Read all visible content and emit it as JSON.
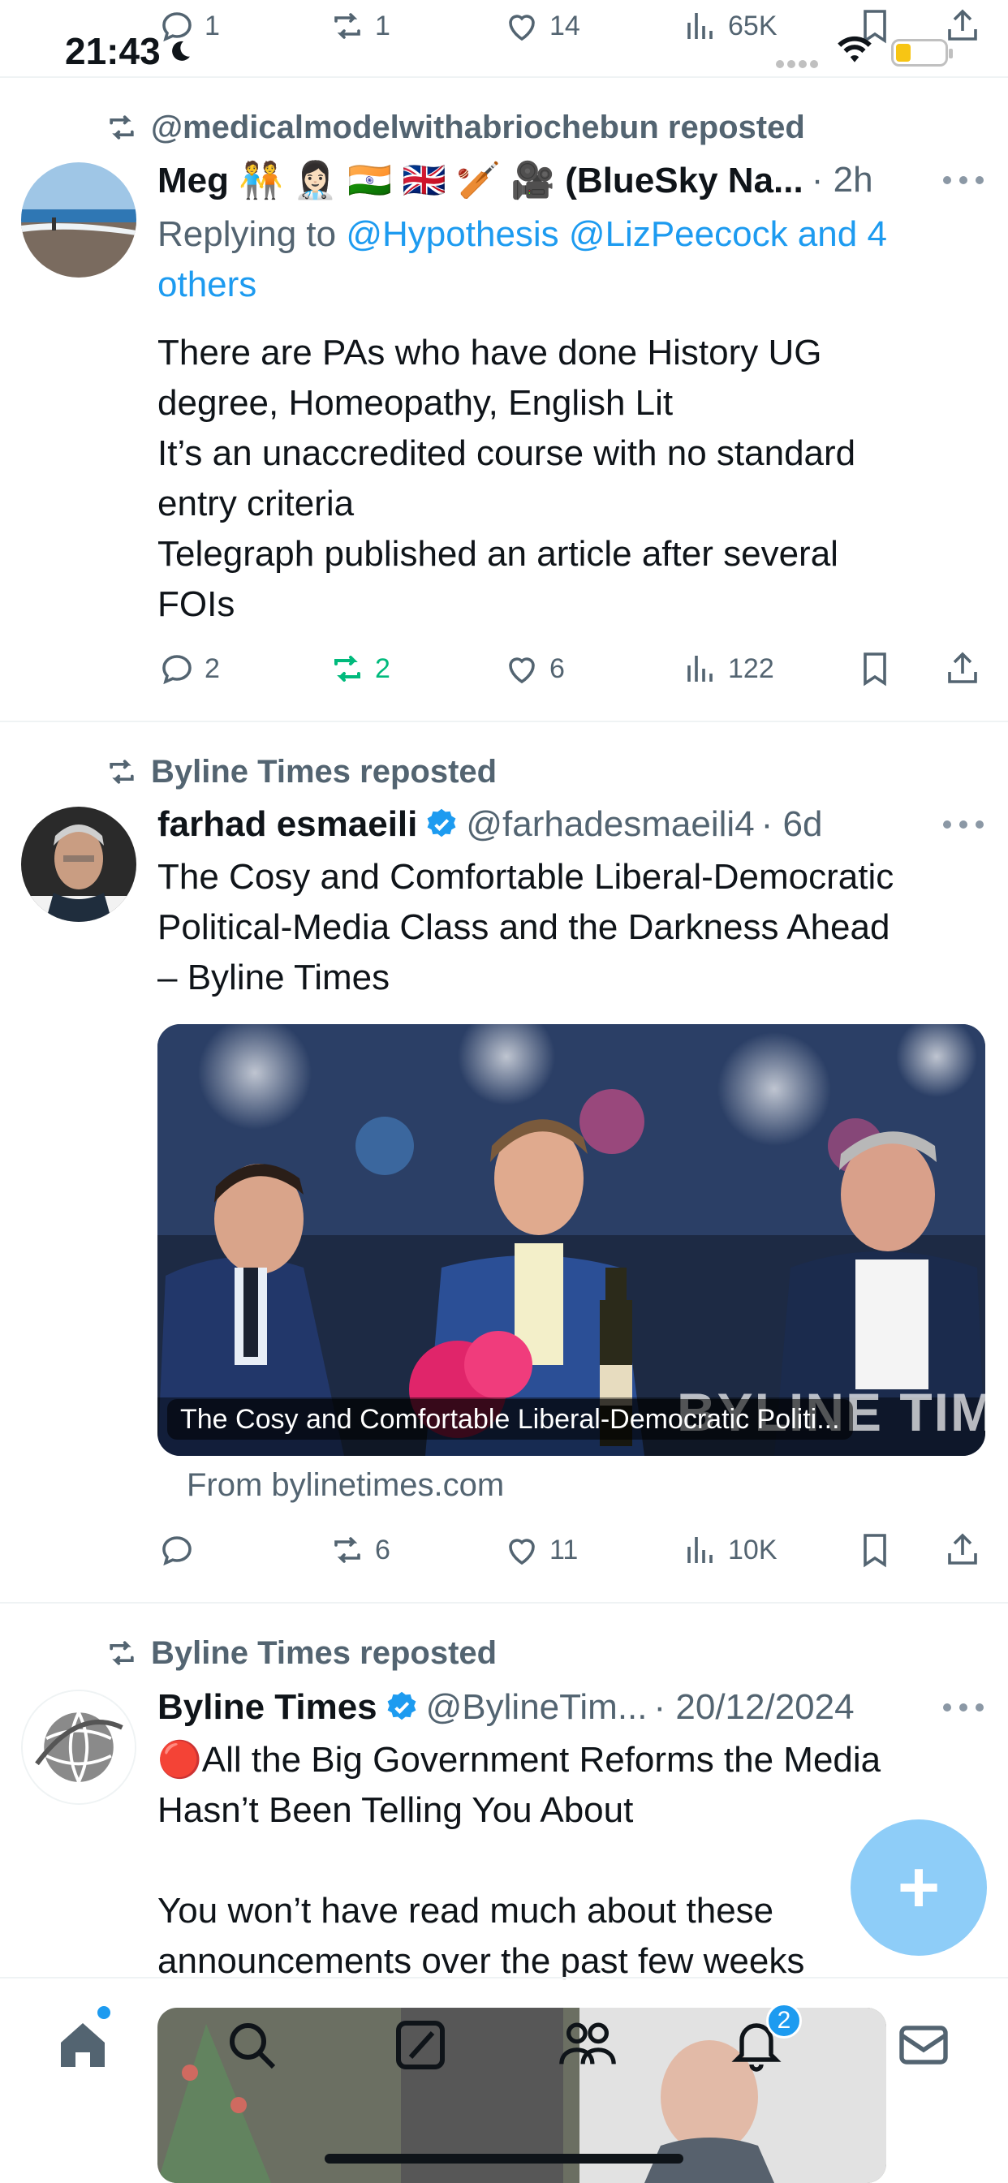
{
  "status_bar": {
    "time": "21:43"
  },
  "top_actions": {
    "replies": "1",
    "reposts": "1",
    "likes": "14",
    "views": "65K"
  },
  "tweets": [
    {
      "repost_label": "@medicalmodelwithabriochebun reposted",
      "name": "Meg 🧑‍🤝‍🧑 👩🏻‍⚕️ 🇮🇳 🇬🇧 🏏 🎥 (BlueSky Na...",
      "time": "· 2h",
      "replying_prefix": "Replying to ",
      "replying_to_line1": "@Hypothesis @LizPeecock and 4",
      "replying_to_line2": "others",
      "text_lines": [
        "There are PAs who have done History UG",
        "degree, Homeopathy, English Lit",
        "It’s an unaccredited course with no standard",
        "entry criteria",
        "Telegraph published an article after several",
        "FOIs"
      ],
      "replies": "2",
      "reposts": "2",
      "likes": "6",
      "views": "122"
    },
    {
      "repost_label": "Byline Times reposted",
      "name": "farhad esmaeili",
      "handle": "@farhadesmaeili4",
      "time": "· 6d",
      "text_lines": [
        "The Cosy and Comfortable Liberal-Democratic",
        "Political-Media Class and the Darkness Ahead",
        "– Byline Times"
      ],
      "card_caption": "The Cosy and Comfortable Liberal-Democratic Politi...",
      "card_watermark": "BYLINE TIMES",
      "card_source": "From bylinetimes.com",
      "replies": "",
      "reposts": "6",
      "likes": "11",
      "views": "10K"
    },
    {
      "repost_label": "Byline Times reposted",
      "name": "Byline Times",
      "handle": "@BylineTim...",
      "time": "· 20/12/2024",
      "text_lines": [
        "🔴All the Big Government Reforms the Media",
        "Hasn’t Been Telling You About",
        "",
        "You won’t have read much about these",
        "announcements over the past few weeks"
      ]
    }
  ],
  "fab": {
    "label": "+"
  },
  "bottom_nav": {
    "notifications_badge": "2"
  },
  "colors": {
    "accent": "#1d9bf0",
    "repost_green": "#00ba7c",
    "muted": "#536471",
    "fab": "#8ecdf8"
  }
}
